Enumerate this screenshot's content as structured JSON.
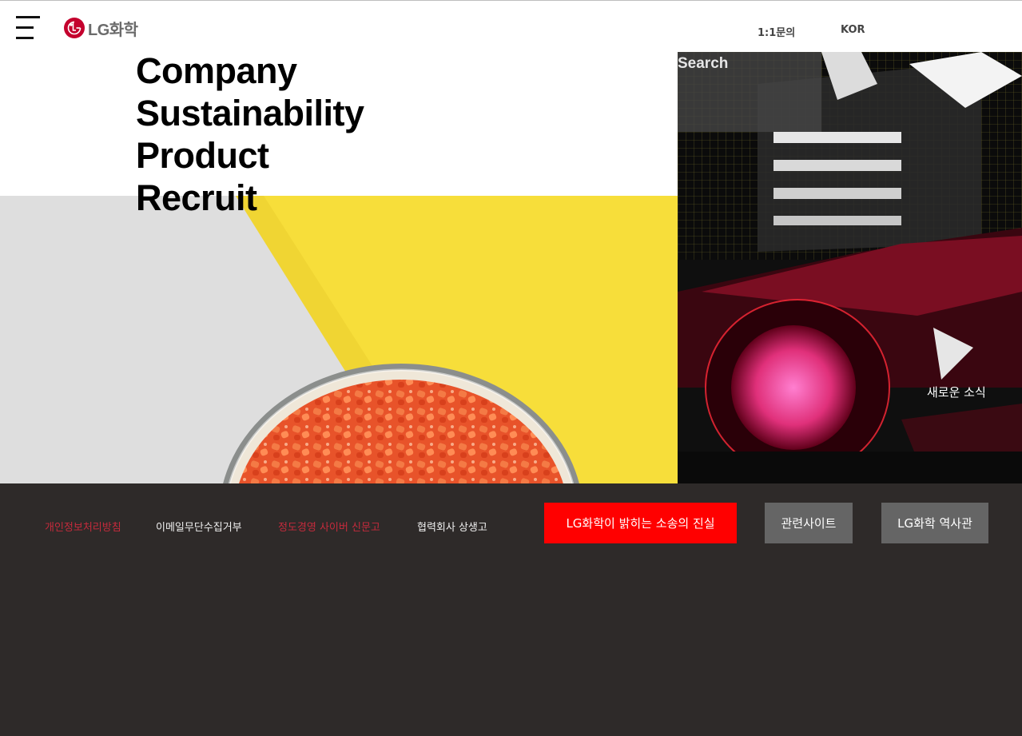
{
  "header": {
    "logo_text": "LG화학",
    "util_links": [
      "1:1문의",
      "KOR"
    ]
  },
  "nav": {
    "items": [
      "Company",
      "Sustainability",
      "Product",
      "Recruit"
    ]
  },
  "search": {
    "label": "Search"
  },
  "promo": {
    "news_label": "새로운 소식"
  },
  "footer": {
    "links": [
      "개인정보처리방침",
      "이메일무단수집거부",
      "정도경영 사이버 신문고",
      "협력회사 상생고"
    ],
    "buttons": [
      "LG화학이 밝히는 소송의 진실",
      "관련사이트",
      "LG화학 역사관"
    ]
  },
  "colors": {
    "brand_red": "#c4002d",
    "cta_red": "#ff0000",
    "footer_bg": "#2e2a29",
    "footer_button_gray": "#656565",
    "footer_link_red": "#c42a3c",
    "hero_yellow": "#f7de3a",
    "hero_gray": "#dedede"
  },
  "icons": [
    "hamburger-menu-icon",
    "lg-logo-mark-icon"
  ]
}
